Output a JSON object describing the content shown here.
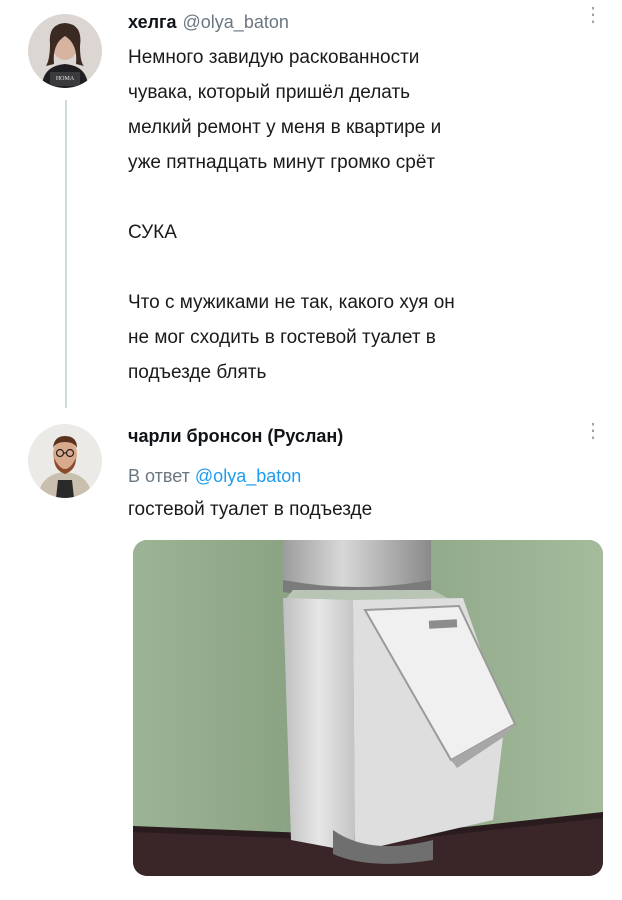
{
  "tweet1": {
    "name": "хелга",
    "handle": "@olya_baton",
    "text": "Немного завидую раскованности\nчувака, который пришёл делать\nмелкий ремонт у меня в квартире и\nуже пятнадцать минут громко срёт\n\nСУКА\n\nЧто с мужиками не так, какого хуя он\nне мог сходить в гостевой туалет в\nподъезде блять",
    "more_icon": "more-vertical-icon"
  },
  "tweet2": {
    "name": "чарли бронсон (Руслан)",
    "reply_prefix": "В ответ",
    "reply_mention": "@olya_baton",
    "text": "гостевой туалет в подъезде",
    "more_icon": "more-vertical-icon"
  },
  "colors": {
    "link": "#1d9bf0",
    "secondary_text": "#6b7780",
    "thread_line": "#cfd9de"
  }
}
